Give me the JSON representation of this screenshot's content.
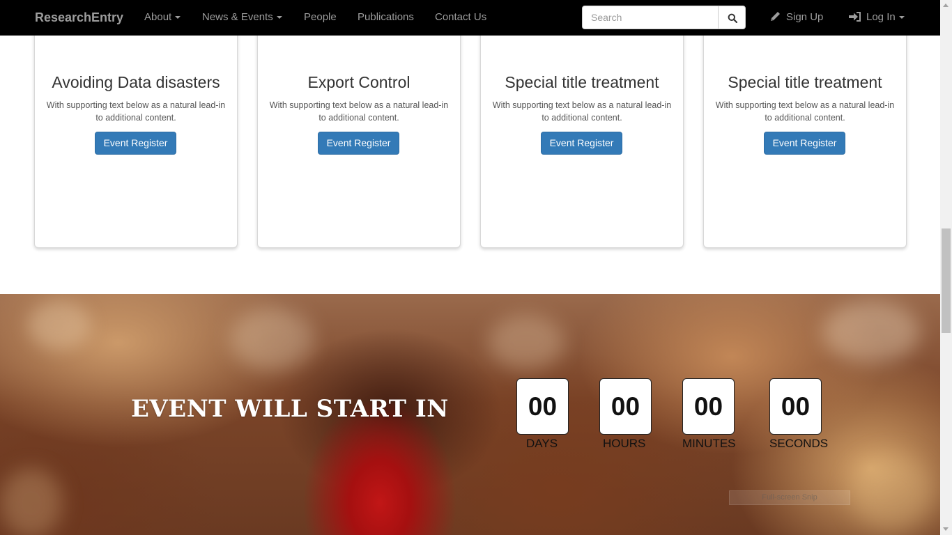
{
  "navbar": {
    "brand": "ResearchEntry",
    "items": [
      {
        "label": "About",
        "dropdown": true
      },
      {
        "label": "News & Events",
        "dropdown": true
      },
      {
        "label": "People",
        "dropdown": false
      },
      {
        "label": "Publications",
        "dropdown": false
      },
      {
        "label": "Contact Us",
        "dropdown": false
      }
    ],
    "search": {
      "placeholder": "Search",
      "value": ""
    },
    "signup_label": "Sign Up",
    "login_label": "Log In"
  },
  "cards": [
    {
      "title": "Avoiding Data disasters",
      "text": "With supporting text below as a natural lead-in to additional content.",
      "button": "Event Register"
    },
    {
      "title": "Export Control",
      "text": "With supporting text below as a natural lead-in to additional content.",
      "button": "Event Register"
    },
    {
      "title": "Special title treatment",
      "text": "With supporting text below as a natural lead-in to additional content.",
      "button": "Event Register"
    },
    {
      "title": "Special title treatment",
      "text": "With supporting text below as a natural lead-in to additional content.",
      "button": "Event Register"
    }
  ],
  "countdown": {
    "heading": "EVENT WILL START IN",
    "units": [
      {
        "value": "00",
        "label": "DAYS"
      },
      {
        "value": "00",
        "label": "HOURS"
      },
      {
        "value": "00",
        "label": "MINUTES"
      },
      {
        "value": "00",
        "label": "SECONDS"
      }
    ]
  },
  "overlay": {
    "snip_label": "Full-screen Snip"
  },
  "colors": {
    "navbar_bg": "#000000",
    "nav_text": "#9d9d9d",
    "button_primary": "#337ab7",
    "card_title": "#333333"
  },
  "icons": [
    "search-icon",
    "pencil-icon",
    "sign-in-icon",
    "caret-down-icon"
  ]
}
